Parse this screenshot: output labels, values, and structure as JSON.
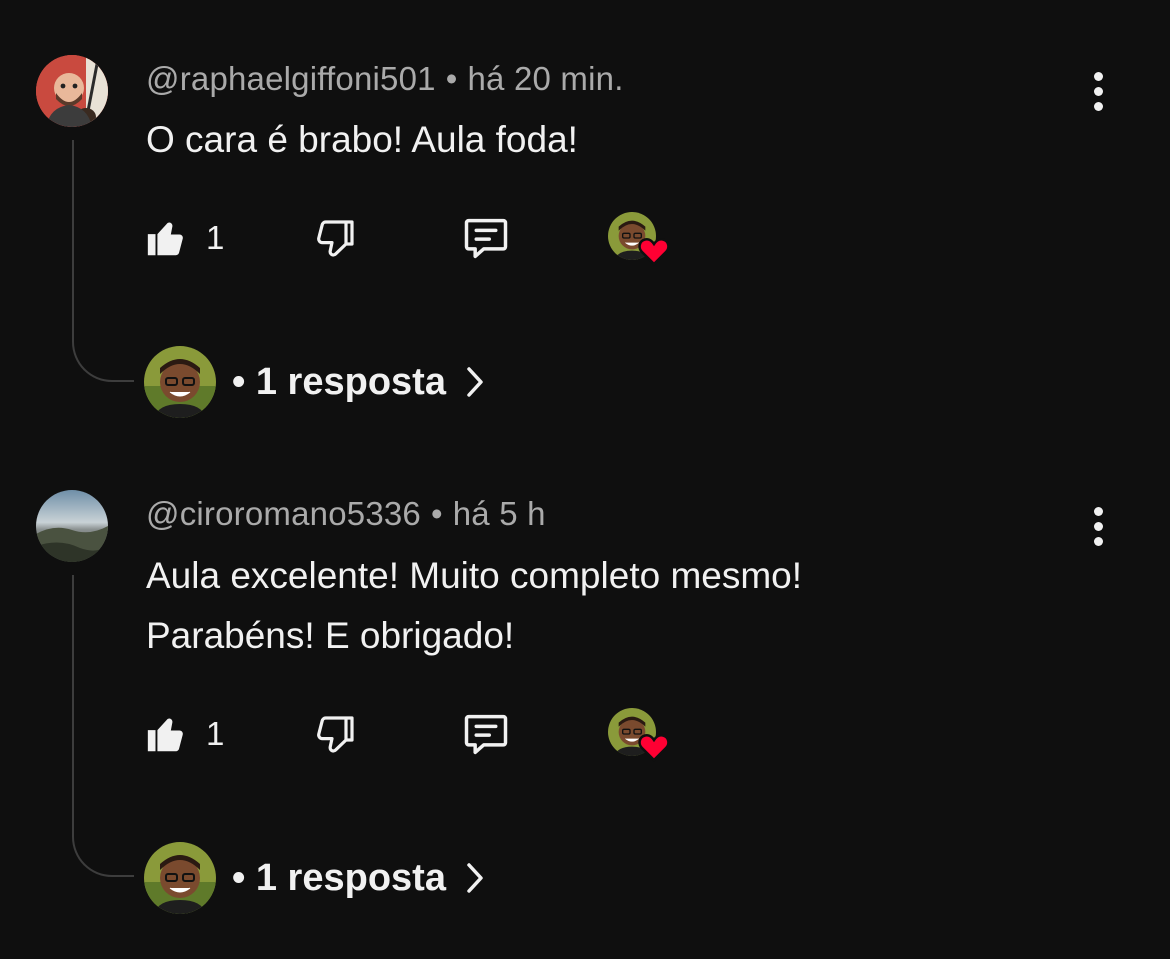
{
  "comments": [
    {
      "author": "@raphaelgiffoni501",
      "separator": "•",
      "time": "há 20 min.",
      "text_lines": [
        "O cara é brabo! Aula foda!"
      ],
      "likes": "1",
      "replies_label": "• 1 resposta",
      "avatar_icon": "person-guitar-avatar"
    },
    {
      "author": "@ciroromano5336",
      "separator": "•",
      "time": "há 5 h",
      "text_lines": [
        "Aula excelente! Muito completo mesmo!",
        "Parabéns! E obrigado!"
      ],
      "likes": "1",
      "replies_label": "• 1 resposta",
      "avatar_icon": "landscape-avatar"
    }
  ],
  "icons": {
    "like": "thumbs-up-icon",
    "dislike": "thumbs-down-icon",
    "reply": "comment-icon",
    "heart": "heart-icon",
    "more": "more-vertical-icon",
    "chevron": "chevron-right-icon"
  },
  "colors": {
    "background": "#0f0f0f",
    "text_primary": "#f1f1f1",
    "text_secondary": "#aaaaaa",
    "heart": "#ff0033",
    "thread_line": "#3d3d3d"
  }
}
